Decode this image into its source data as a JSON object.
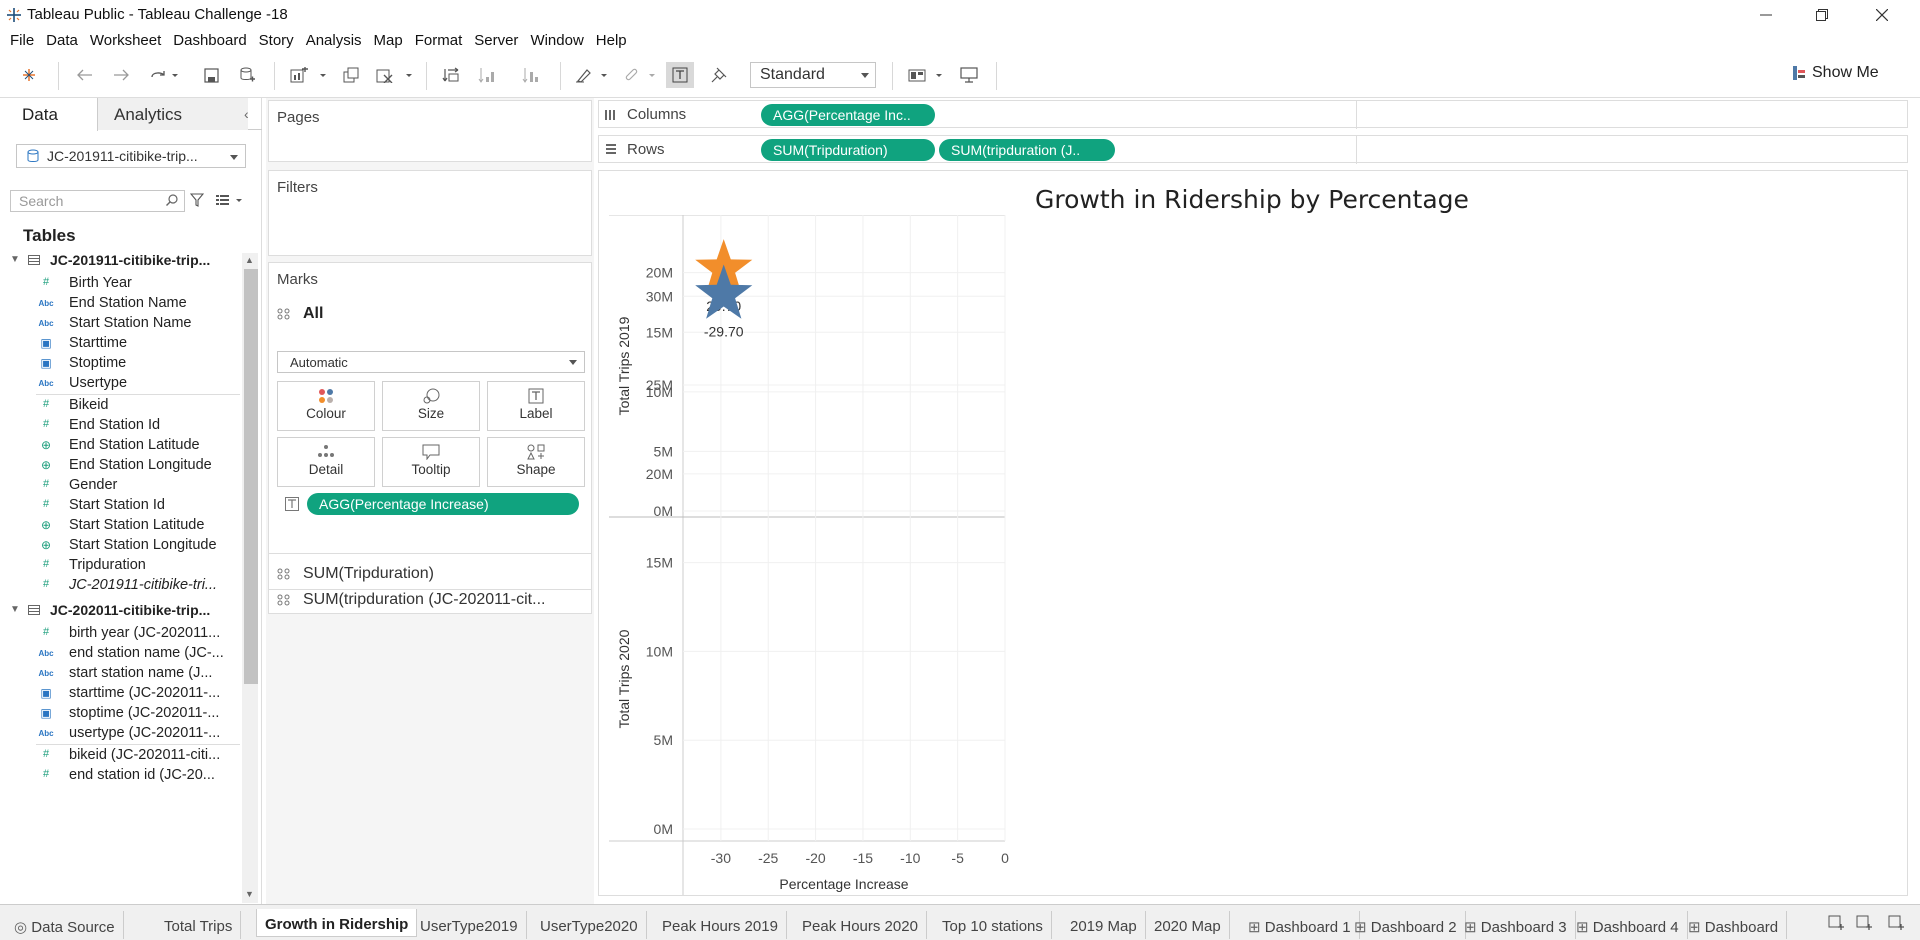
{
  "window": {
    "title": "Tableau Public - Tableau Challenge -18"
  },
  "menu": [
    "File",
    "Data",
    "Worksheet",
    "Dashboard",
    "Story",
    "Analysis",
    "Map",
    "Format",
    "Server",
    "Window",
    "Help"
  ],
  "toolbar": {
    "fit_select": "Standard",
    "show_me": "Show Me"
  },
  "sidepanel": {
    "tab_data": "Data",
    "tab_analytics": "Analytics",
    "datasource": "JC-201911-citibike-trip...",
    "search_placeholder": "Search",
    "tables_heading": "Tables",
    "group1": "JC-201911-citibike-trip...",
    "fields1": [
      {
        "label": "Birth Year",
        "type": "num"
      },
      {
        "label": "End Station Name",
        "type": "abc"
      },
      {
        "label": "Start Station Name",
        "type": "abc"
      },
      {
        "label": "Starttime",
        "type": "dt"
      },
      {
        "label": "Stoptime",
        "type": "dt"
      },
      {
        "label": "Usertype",
        "type": "abc"
      },
      {
        "label": "Bikeid",
        "type": "num"
      },
      {
        "label": "End Station Id",
        "type": "num"
      },
      {
        "label": "End Station Latitude",
        "type": "geo"
      },
      {
        "label": "End Station Longitude",
        "type": "geo"
      },
      {
        "label": "Gender",
        "type": "num"
      },
      {
        "label": "Start Station Id",
        "type": "num"
      },
      {
        "label": "Start Station Latitude",
        "type": "geo"
      },
      {
        "label": "Start Station Longitude",
        "type": "geo"
      },
      {
        "label": "Tripduration",
        "type": "num"
      },
      {
        "label": "JC-201911-citibike-tri...",
        "type": "num",
        "italic": true
      }
    ],
    "group2": "JC-202011-citibike-trip...",
    "fields2": [
      {
        "label": "birth year (JC-202011...",
        "type": "num"
      },
      {
        "label": "end station name (JC-...",
        "type": "abc"
      },
      {
        "label": "start station name (J...",
        "type": "abc"
      },
      {
        "label": "starttime (JC-202011-...",
        "type": "dt"
      },
      {
        "label": "stoptime (JC-202011-...",
        "type": "dt"
      },
      {
        "label": "usertype (JC-202011-...",
        "type": "abc"
      },
      {
        "label": "bikeid (JC-202011-citi...",
        "type": "num"
      },
      {
        "label": "end station id (JC-20...",
        "type": "num"
      }
    ]
  },
  "shelves": {
    "pages": "Pages",
    "filters": "Filters",
    "marks": "Marks",
    "marks_all": "All",
    "mark_type": "Automatic",
    "buttons": [
      "Colour",
      "Size",
      "Label",
      "Detail",
      "Tooltip",
      "Shape"
    ],
    "label_pill": "AGG(Percentage Increase)",
    "mark_card_1": "SUM(Tripduration)",
    "mark_card_2": "SUM(tripduration (JC-202011-cit..."
  },
  "columns": {
    "label": "Columns",
    "pills": [
      "AGG(Percentage Inc.."
    ]
  },
  "rows": {
    "label": "Rows",
    "pills": [
      "SUM(Tripduration)",
      "SUM(tripduration (J.."
    ]
  },
  "chart_data": {
    "type": "scatter",
    "title": "Growth in Ridership by Percentage",
    "xlabel": "Percentage Increase",
    "xticks": [
      "-30",
      "-25",
      "-20",
      "-15",
      "-10",
      "-5",
      "0"
    ],
    "xlim": [
      -34,
      0
    ],
    "panes": [
      {
        "ylabel": "Total Trips 2019",
        "yticks": [
          "0M",
          "5M",
          "10M",
          "15M",
          "20M"
        ],
        "ylim": [
          0,
          24
        ],
        "points": [
          {
            "x": -29.7,
            "y": 20.3,
            "label": "29.70",
            "color": "#f28e2b"
          }
        ]
      },
      {
        "ylabel": "Total Trips 2020",
        "yticks": [
          "0M",
          "5M",
          "10M",
          "15M",
          "20M",
          "25M",
          "30M"
        ],
        "ylim": [
          0,
          33
        ],
        "points": [
          {
            "x": -29.7,
            "y": 30.1,
            "label": "-29.70",
            "color": "#4e79a7"
          }
        ]
      }
    ]
  },
  "sheet_tabs": [
    "Data Source",
    "Total Trips",
    "Growth in Ridership",
    "UserType2019",
    "UserType2020",
    "Peak Hours 2019",
    "Peak Hours 2020",
    "Top 10 stations",
    "2019 Map",
    "2020 Map",
    "Dashboard 1",
    "Dashboard 2",
    "Dashboard 3",
    "Dashboard 4",
    "Dashboard"
  ],
  "active_tab": "Growth in Ridership",
  "colors": {
    "pill": "#10a37f",
    "star_2019": "#f28e2b",
    "star_2020": "#4e79a7"
  }
}
